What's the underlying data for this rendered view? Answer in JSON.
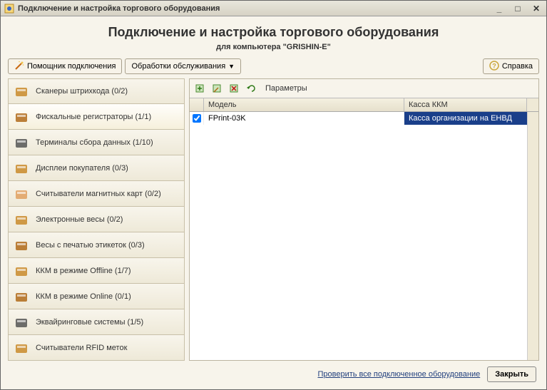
{
  "window": {
    "title": "Подключение и настройка торгового оборудования"
  },
  "header": {
    "heading": "Подключение и настройка торгового оборудования",
    "subheading": "для компьютера \"GRISHIN-E\""
  },
  "toolbar": {
    "wizard_label": "Помощник подключения",
    "maintenance_label": "Обработки обслуживания",
    "help_label": "Справка"
  },
  "sidebar": {
    "items": [
      {
        "label": "Сканеры штрихкода (0/2)",
        "icon": "barcode-scanner-icon",
        "active": false
      },
      {
        "label": "Фискальные регистраторы (1/1)",
        "icon": "fiscal-register-icon",
        "active": true
      },
      {
        "label": "Терминалы сбора данных (1/10)",
        "icon": "data-terminal-icon",
        "active": false
      },
      {
        "label": "Дисплеи покупателя (0/3)",
        "icon": "customer-display-icon",
        "active": false
      },
      {
        "label": "Считыватели магнитных карт (0/2)",
        "icon": "card-reader-icon",
        "active": false
      },
      {
        "label": "Электронные весы (0/2)",
        "icon": "scale-icon",
        "active": false
      },
      {
        "label": "Весы с печатью этикеток (0/3)",
        "icon": "label-scale-icon",
        "active": false
      },
      {
        "label": "ККМ в режиме Offline (1/7)",
        "icon": "kkm-offline-icon",
        "active": false
      },
      {
        "label": "ККМ в режиме Online (0/1)",
        "icon": "kkm-online-icon",
        "active": false
      },
      {
        "label": "Эквайринговые системы (1/5)",
        "icon": "acquiring-icon",
        "active": false
      },
      {
        "label": "Считыватели RFID меток",
        "icon": "rfid-icon",
        "active": false
      }
    ]
  },
  "grid": {
    "toolbar": {
      "params_label": "Параметры"
    },
    "columns": {
      "model": "Модель",
      "kassa": "Касса ККМ"
    },
    "rows": [
      {
        "checked": true,
        "model": "FPrint-03K",
        "kassa": "Касса организации на ЕНВД",
        "selected": true
      }
    ]
  },
  "footer": {
    "check_all_label": "Проверить все подключенное оборудование",
    "close_label": "Закрыть"
  }
}
